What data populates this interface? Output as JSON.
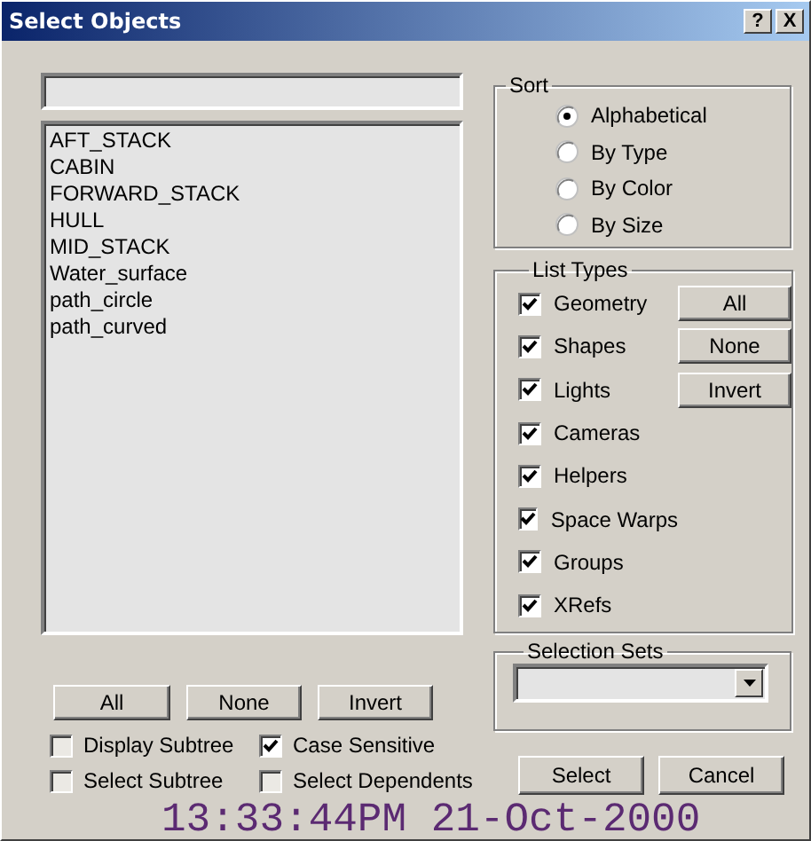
{
  "window": {
    "title": "Select Objects",
    "help_button": "?",
    "close_button": "X"
  },
  "objects": [
    {
      "name": "AFT_STACK",
      "selected": false
    },
    {
      "name": "CABIN",
      "selected": false
    },
    {
      "name": "FORWARD_STACK",
      "selected": false
    },
    {
      "name": "HULL",
      "selected": false
    },
    {
      "name": "MID_STACK",
      "selected": false
    },
    {
      "name": "Water_surface",
      "selected": false
    },
    {
      "name": "path_circle",
      "selected": false
    },
    {
      "name": "path_curved",
      "selected": false
    }
  ],
  "list_buttons": [
    "All",
    "None",
    "Invert"
  ],
  "options": [
    {
      "label": "Display Subtree",
      "checked": false
    },
    {
      "label": "Case Sensitive",
      "checked": true
    },
    {
      "label": "Select Subtree",
      "checked": false
    },
    {
      "label": "Select Dependents",
      "checked": false
    }
  ],
  "sort": {
    "title": "Sort",
    "options": [
      {
        "label": "Alphabetical",
        "selected": true
      },
      {
        "label": "By Type",
        "selected": false
      },
      {
        "label": "By Color",
        "selected": false
      },
      {
        "label": "By Size",
        "selected": false
      }
    ]
  },
  "list_types": {
    "title": "List Types",
    "types": [
      {
        "label": "Geometry",
        "checked": true
      },
      {
        "label": "Shapes",
        "checked": true
      },
      {
        "label": "Lights",
        "checked": true
      },
      {
        "label": "Cameras",
        "checked": true
      },
      {
        "label": "Helpers",
        "checked": true
      },
      {
        "label": "Space Warps",
        "checked": true
      },
      {
        "label": "Groups",
        "checked": true
      },
      {
        "label": "XRefs",
        "checked": true
      }
    ],
    "buttons": [
      "All",
      "None",
      "Invert"
    ]
  },
  "selection_sets": {
    "title": "Selection Sets"
  },
  "buttons": [
    "Select",
    "Cancel"
  ],
  "timestamp": "13:33:44PM 21-Oct-2000"
}
